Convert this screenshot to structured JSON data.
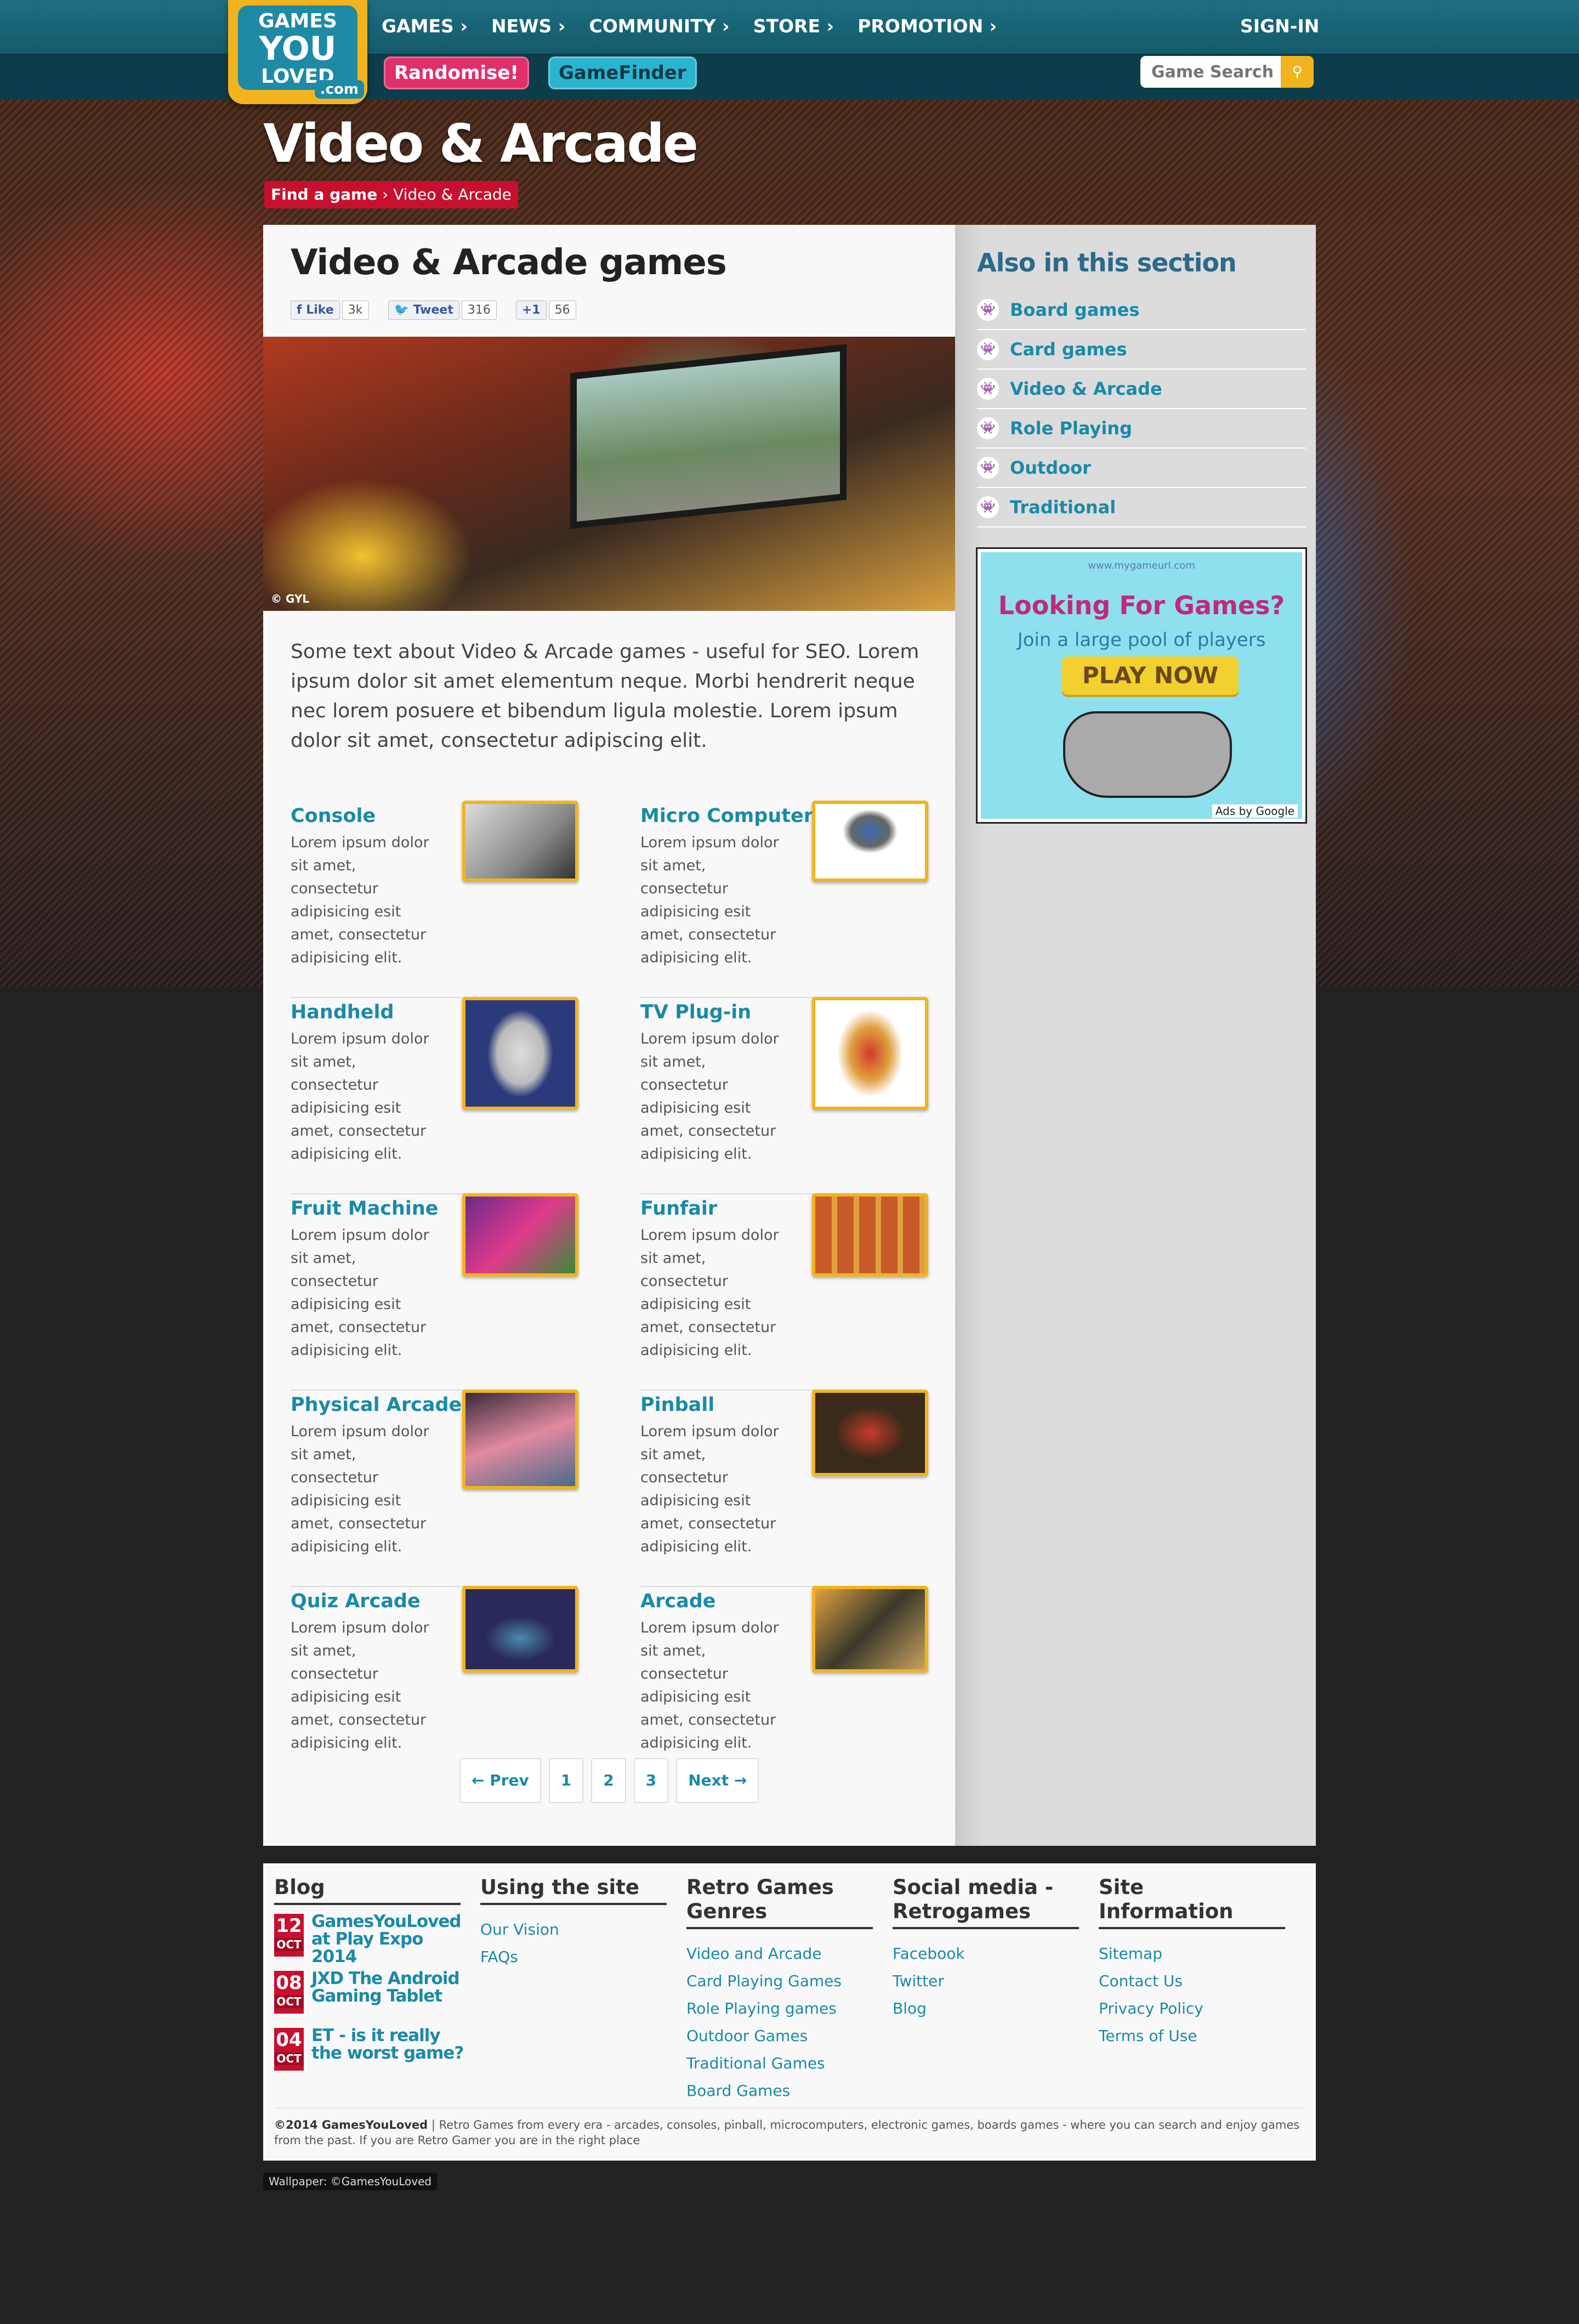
{
  "header": {
    "logo": {
      "line1": "GAMES",
      "line2": "YOU",
      "line3": "LOVED",
      "com": ".com"
    },
    "nav": [
      {
        "label": "GAMES ›"
      },
      {
        "label": "NEWS ›"
      },
      {
        "label": "COMMUNITY ›"
      },
      {
        "label": "STORE ›"
      },
      {
        "label": "PROMOTION ›"
      }
    ],
    "signin": "SIGN-IN",
    "randomise": "Randomise!",
    "gamefinder": "GameFinder",
    "search_placeholder": "Game Search"
  },
  "page": {
    "title": "Video & Arcade",
    "breadcrumb": {
      "root": "Find a game",
      "current": "Video & Arcade"
    }
  },
  "main": {
    "heading": "Video & Arcade games",
    "social": {
      "like": "Like",
      "like_count": "3k",
      "tweet": "Tweet",
      "tweet_count": "316",
      "plus": "+1",
      "plus_count": "56"
    },
    "photo_credit": "© GYL",
    "intro": "Some text about Video & Arcade games - useful for SEO. Lorem ipsum dolor sit amet elementum neque. Morbi hendrerit neque nec lorem posuere et bibendum ligula molestie. Lorem ipsum dolor sit amet, consectetur adipiscing elit.",
    "items": [
      {
        "title": "Console",
        "desc": "Lorem ipsum dolor sit amet, consectetur adipisicing esit amet, consectetur adipisicing elit."
      },
      {
        "title": "Micro Computer",
        "desc": "Lorem ipsum dolor sit amet, consectetur adipisicing esit amet, consectetur adipisicing elit."
      },
      {
        "title": "Handheld",
        "desc": "Lorem ipsum dolor sit amet, consectetur adipisicing esit amet, consectetur adipisicing elit."
      },
      {
        "title": "TV Plug-in",
        "desc": "Lorem ipsum dolor sit amet, consectetur adipisicing esit amet, consectetur adipisicing elit."
      },
      {
        "title": "Fruit Machine",
        "desc": "Lorem ipsum dolor sit amet, consectetur adipisicing esit amet, consectetur adipisicing elit."
      },
      {
        "title": "Funfair",
        "desc": "Lorem ipsum dolor sit amet, consectetur adipisicing esit amet, consectetur adipisicing elit."
      },
      {
        "title": "Physical Arcade",
        "desc": "Lorem ipsum dolor sit amet, consectetur adipisicing esit amet, consectetur adipisicing elit."
      },
      {
        "title": "Pinball",
        "desc": "Lorem ipsum dolor sit amet, consectetur adipisicing esit amet, consectetur adipisicing elit."
      },
      {
        "title": "Quiz Arcade",
        "desc": "Lorem ipsum dolor sit amet, consectetur adipisicing esit amet, consectetur adipisicing elit."
      },
      {
        "title": "Arcade",
        "desc": "Lorem ipsum dolor sit amet, consectetur adipisicing esit amet, consectetur adipisicing elit."
      }
    ],
    "pager": {
      "prev": "← Prev",
      "p1": "1",
      "p2": "2",
      "p3": "3",
      "next": "Next →"
    }
  },
  "sidebar": {
    "heading": "Also in this section",
    "items": [
      {
        "label": "Board games"
      },
      {
        "label": "Card games"
      },
      {
        "label": "Video & Arcade"
      },
      {
        "label": "Role Playing"
      },
      {
        "label": "Outdoor"
      },
      {
        "label": "Traditional"
      }
    ],
    "ad": {
      "url": "www.mygameurl.com",
      "headline": "Looking For Games?",
      "sub": "Join a large pool of players",
      "button": "PLAY NOW",
      "footer": "Ads by Google"
    }
  },
  "footer": {
    "blog": {
      "heading": "Blog",
      "posts": [
        {
          "day": "12",
          "month": "OCT",
          "title": "GamesYouLoved at Play Expo 2014"
        },
        {
          "day": "08",
          "month": "OCT",
          "title": "JXD The Android Gaming Tablet"
        },
        {
          "day": "04",
          "month": "OCT",
          "title": "ET - is it really the worst game?"
        }
      ]
    },
    "using": {
      "heading": "Using the site",
      "links": [
        "Our Vision",
        "FAQs"
      ]
    },
    "genres": {
      "heading": "Retro Games Genres",
      "links": [
        "Video and Arcade",
        "Card Playing Games",
        "Role Playing games",
        "Outdoor Games",
        "Traditional Games",
        "Board Games"
      ]
    },
    "social": {
      "heading": "Social media - Retrogames",
      "links": [
        "Facebook",
        "Twitter",
        "Blog"
      ]
    },
    "info": {
      "heading": "Site Information",
      "links": [
        "Sitemap",
        "Contact Us",
        "Privacy Policy",
        "Terms of Use"
      ]
    },
    "copyright_brand": "©2014 GamesYouLoved",
    "copyright_text": " | Retro Games from every era - arcades, consoles, pinball, microcomputers, electronic games, boards games - where you can search and enjoy games from the past. If you are Retro Gamer you are in the right place",
    "wallpaper": "Wallpaper: ©GamesYouLoved"
  },
  "colors": {
    "accent": "#1a8aa8",
    "brand_yellow": "#f2b41e",
    "breadcrumb_red": "#c8102e"
  }
}
